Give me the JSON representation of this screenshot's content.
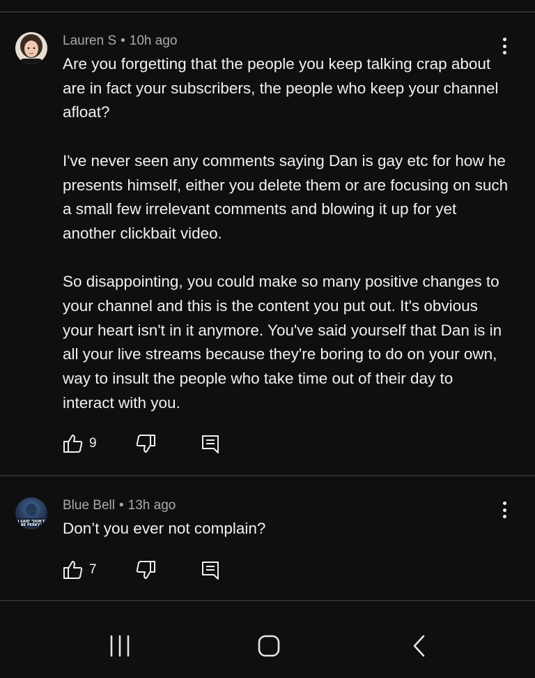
{
  "comments": [
    {
      "author": "Lauren S",
      "time": "10h ago",
      "paragraphs": [
        "Are you forgetting that the people you keep talking crap about are in fact your subscribers, the people who keep your channel afloat?",
        "I've never seen any comments saying Dan is gay etc for how he presents himself, either you delete them or are focusing on such a small few irrelevant comments and blowing it up for yet another clickbait video.",
        "So disappointing, you could make so many positive changes to your channel and this is the content you put out. It's obvious your heart isn't in it anymore. You've said yourself that Dan is in all your live streams because they're boring to do on your own, way to insult the people who take time out of their day to interact with you."
      ],
      "likes": "9"
    },
    {
      "author": "Blue Bell",
      "time": "13h ago",
      "paragraphs": [
        "Don’t you ever not complain?"
      ],
      "likes": "7",
      "avatar_text": "I SAID \"DON'T BE PERKY\""
    }
  ],
  "separator": "•",
  "icons": {
    "like": "thumbs-up-icon",
    "dislike": "thumbs-down-icon",
    "reply": "reply-comment-icon",
    "more": "more-vertical-icon",
    "nav_recents": "recent-apps-icon",
    "nav_home": "home-icon",
    "nav_back": "back-chevron-icon"
  },
  "colors": {
    "background": "#0f0f0f",
    "text": "#f1f1f1",
    "meta": "#aaaaaa",
    "divider": "#2e2e2e"
  }
}
